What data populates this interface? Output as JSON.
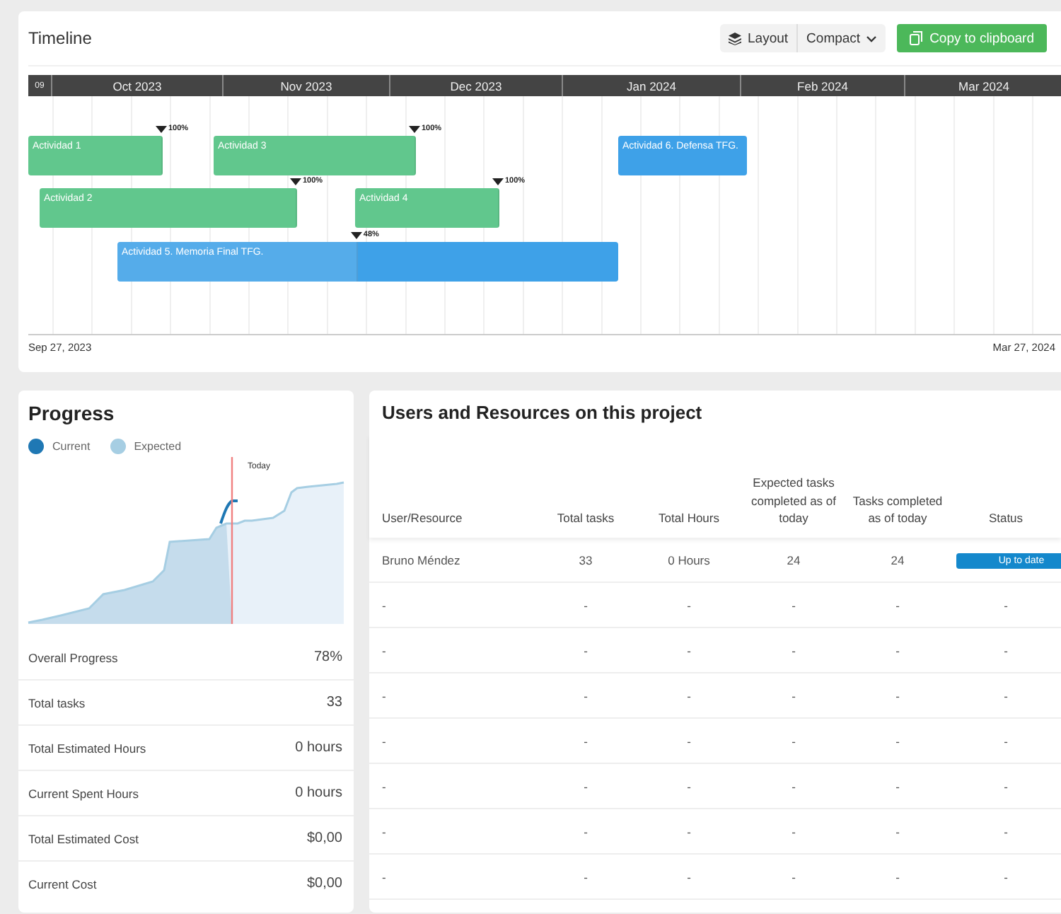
{
  "timeline": {
    "title": "Timeline",
    "layout_button": "Layout",
    "layout_select": "Compact",
    "copy_button": "Copy to clipboard",
    "months": [
      "09",
      "Oct 2023",
      "Nov 2023",
      "Dec 2023",
      "Jan 2024",
      "Feb 2024",
      "Mar 2024"
    ],
    "tasks": [
      {
        "name": "Actividad 1",
        "color": "#4cc07e",
        "level": 1,
        "progress": "100%"
      },
      {
        "name": "Actividad 3",
        "color": "#4cc07e",
        "level": 1,
        "progress": "100%"
      },
      {
        "name": "Actividad 6. Defensa TFG.",
        "color": "#3ea1e8"
      },
      {
        "name": "Actividad 2",
        "color": "#4cc07e",
        "level": 1,
        "progress": "100%"
      },
      {
        "name": "Actividad 4",
        "color": "#4cc07e",
        "level": 1,
        "progress": "100%"
      },
      {
        "name": "Actividad 5. Memoria Final TFG.",
        "color": "#3ea1e8",
        "level": 0.48,
        "progress": "48%"
      }
    ],
    "start_date": "Sep 27, 2023",
    "end_date": "Mar 27, 2024"
  },
  "progress": {
    "title": "Progress",
    "legend": [
      {
        "label": "Current",
        "color": "#1f78b4"
      },
      {
        "label": "Expected",
        "color": "#a6cee3"
      }
    ],
    "today_label": "Today",
    "stats": [
      {
        "label": "Overall Progress",
        "value": "78%"
      },
      {
        "label": "Total tasks",
        "value": "33"
      },
      {
        "label": "Total Estimated Hours",
        "value": "0 hours"
      },
      {
        "label": "Current Spent Hours",
        "value": "0 hours"
      },
      {
        "label": "Total Estimated Cost",
        "value": "$0,00"
      },
      {
        "label": "Current Cost",
        "value": "$0,00"
      }
    ]
  },
  "users": {
    "title": "Users and Resources on this project",
    "columns": [
      "User/Resource",
      "Total tasks",
      "Total Hours",
      "Expected tasks completed as of today",
      "Tasks completed as of today",
      "Status"
    ],
    "rows": [
      {
        "cells": [
          "Bruno Méndez",
          "33",
          "0 Hours",
          "24",
          "24"
        ],
        "status": "Up to date",
        "kind": "badge"
      },
      {
        "cells": [
          "-",
          "-",
          "-",
          "-",
          "-"
        ],
        "status": "-",
        "kind": "text"
      },
      {
        "cells": [
          "-",
          "-",
          "-",
          "-",
          "-"
        ],
        "status": "-",
        "kind": "text"
      },
      {
        "cells": [
          "-",
          "-",
          "-",
          "-",
          "-"
        ],
        "status": "-",
        "kind": "text"
      },
      {
        "cells": [
          "-",
          "-",
          "-",
          "-",
          "-"
        ],
        "status": "-",
        "kind": "text"
      },
      {
        "cells": [
          "-",
          "-",
          "-",
          "-",
          "-"
        ],
        "status": "-",
        "kind": "text"
      },
      {
        "cells": [
          "-",
          "-",
          "-",
          "-",
          "-"
        ],
        "status": "-",
        "kind": "text"
      },
      {
        "cells": [
          "-",
          "-",
          "-",
          "-",
          "-"
        ],
        "status": "-",
        "kind": "text"
      }
    ]
  }
}
